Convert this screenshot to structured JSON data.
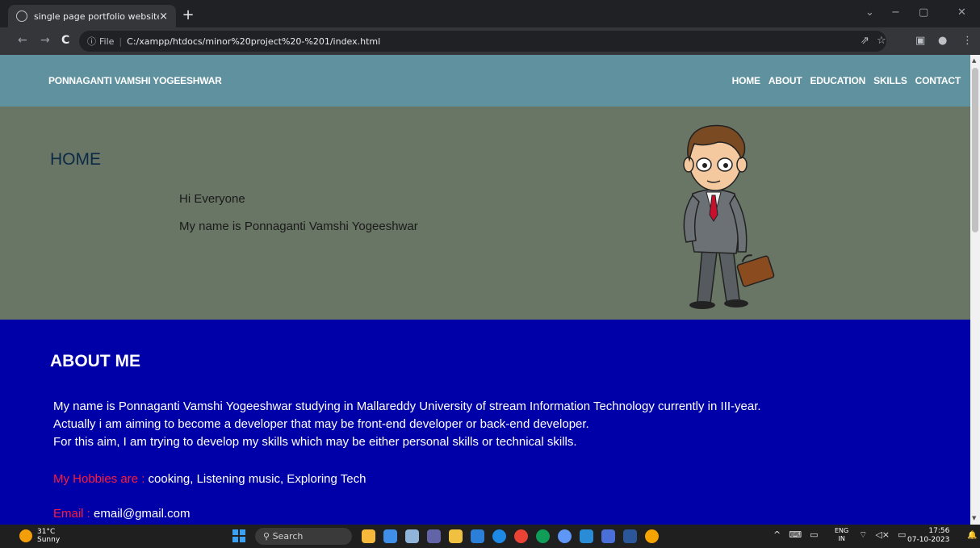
{
  "browser": {
    "tab_title": "single page portfolio website",
    "tab_close": "×",
    "new_tab": "+",
    "address_info": "ⓘ",
    "address_scheme": "File",
    "address_sep": "|",
    "address_url": "C:/xampp/htdocs/minor%20project%20-%201/index.html",
    "win_chevron": "⌄",
    "win_min": "−",
    "win_restore": "▢",
    "win_close": "✕",
    "back": "←",
    "forward": "→",
    "reload": "C",
    "share_icon": "⇗",
    "star_icon": "☆",
    "sidepanel_icon": "▣",
    "profile_icon": "●",
    "menu_icon": "⋮"
  },
  "site": {
    "brand": "PONNAGANTI VAMSHI YOGEESHWAR",
    "menu": [
      "HOME",
      "ABOUT",
      "EDUCATION",
      "SKILLS",
      "CONTACT"
    ],
    "home": {
      "heading": "HOME",
      "line1": "Hi Everyone",
      "line2": "My name is Ponnaganti Vamshi Yogeeshwar"
    },
    "about": {
      "heading": "ABOUT ME",
      "para1": "My name is Ponnaganti Vamshi Yogeeshwar studying in Mallareddy University of stream Information Technology currently in III-year.",
      "para2": "Actually i am aiming to become a developer that may be front-end developer or back-end developer.",
      "para3": "For this aim, I am trying to develop my skills which may be either personal skills or technical skills.",
      "hobbies_label": "My Hobbies are :",
      "hobbies_value": " cooking, Listening music, Exploring Tech",
      "email_label": "Email :",
      "email_value": " email@gmail.com"
    }
  },
  "taskbar": {
    "temp": "31°C",
    "condition": "Sunny",
    "search_icon": "⚲",
    "search_placeholder": "Search",
    "tray_up": "^",
    "lang1": "ENG",
    "lang2": "IN",
    "network_icon": "⌔",
    "volume_icon": "◁×",
    "battery_icon": "▭",
    "time": "17:56",
    "date": "07-10-2023",
    "bell_icon": "🔔"
  },
  "colors": {
    "nav_bg": "#5f929e",
    "home_bg": "#697565",
    "about_bg": "#0000a8",
    "highlight": "#ff1a3c"
  }
}
